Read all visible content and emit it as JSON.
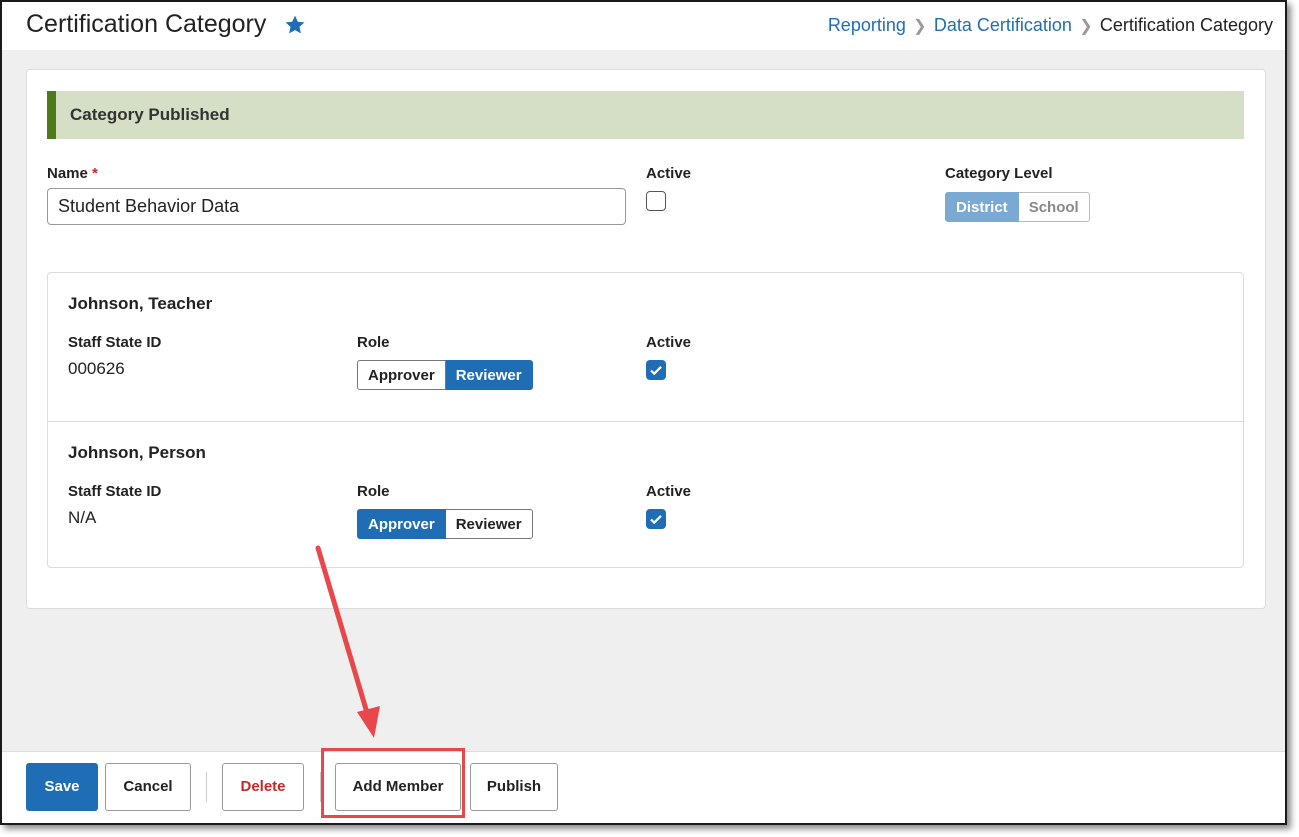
{
  "header": {
    "title": "Certification Category",
    "breadcrumbs": [
      "Reporting",
      "Data Certification",
      "Certification Category"
    ]
  },
  "banner": {
    "text": "Category Published"
  },
  "form": {
    "name_label": "Name",
    "required_mark": "*",
    "name_value": "Student Behavior Data",
    "active_label": "Active",
    "active_checked": false,
    "category_level_label": "Category Level",
    "category_level_options": [
      "District",
      "School"
    ],
    "category_level_selected": "District"
  },
  "members": [
    {
      "name": "Johnson, Teacher",
      "staff_id_label": "Staff State ID",
      "staff_id": "000626",
      "role_label": "Role",
      "role_options": [
        "Approver",
        "Reviewer"
      ],
      "role_selected": "Reviewer",
      "active_label": "Active",
      "active_checked": true
    },
    {
      "name": "Johnson, Person",
      "staff_id_label": "Staff State ID",
      "staff_id": "N/A",
      "role_label": "Role",
      "role_options": [
        "Approver",
        "Reviewer"
      ],
      "role_selected": "Approver",
      "active_label": "Active",
      "active_checked": true
    }
  ],
  "footer": {
    "save": "Save",
    "cancel": "Cancel",
    "delete": "Delete",
    "add_member": "Add Member",
    "publish": "Publish"
  },
  "colors": {
    "accent": "#1f6eb5",
    "banner_bg": "#d4dfc6",
    "banner_bar": "#4d7a1a",
    "danger": "#c62828",
    "annotation": "#e8484c"
  },
  "icons": {
    "favorite": "star-icon",
    "breadcrumb_separator": "chevron-right-icon",
    "checkbox": "check-icon"
  }
}
